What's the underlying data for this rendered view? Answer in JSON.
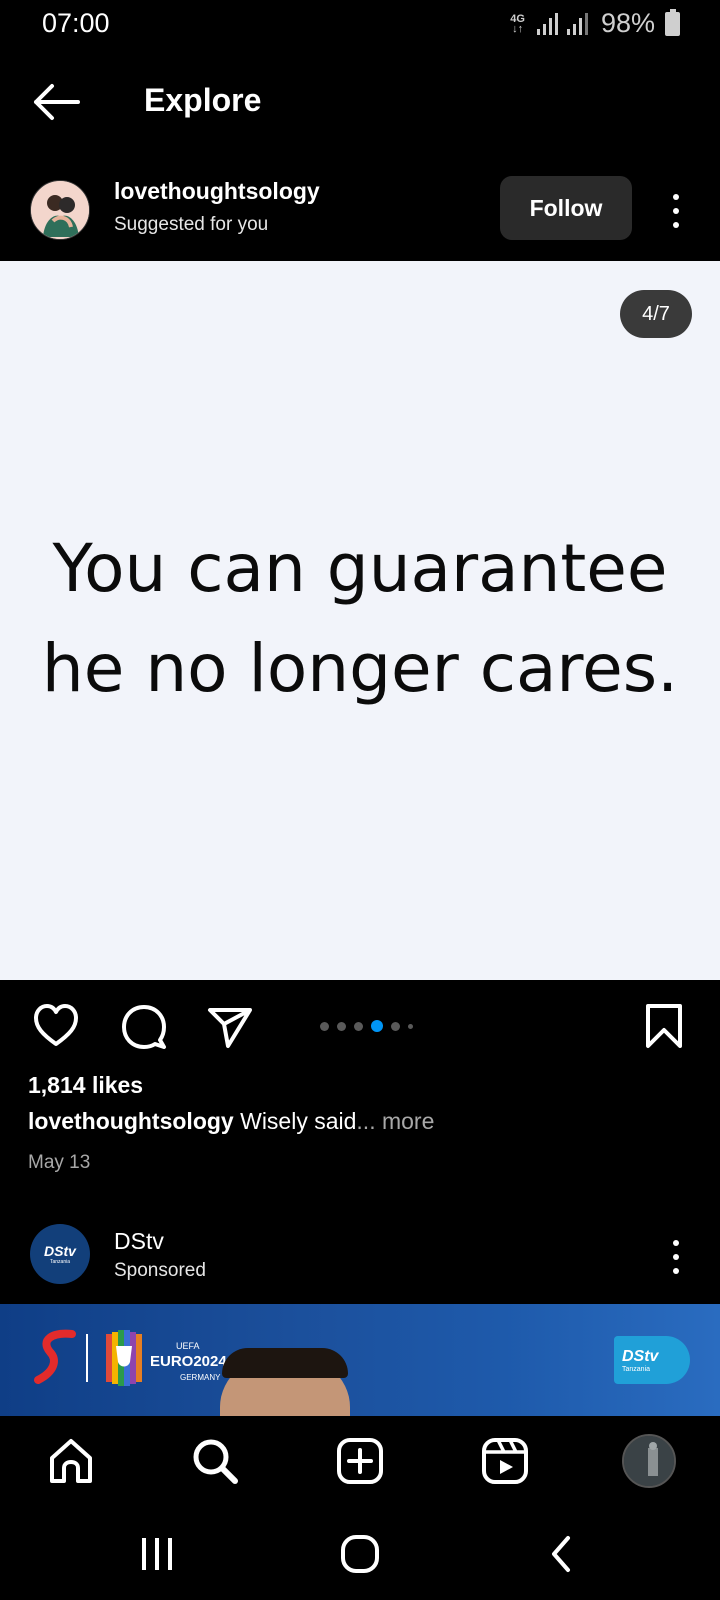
{
  "status_bar": {
    "time": "07:00",
    "network": "4G",
    "battery": "98%"
  },
  "header": {
    "title": "Explore"
  },
  "post": {
    "username": "lovethoughtsology",
    "subtitle": "Suggested for you",
    "follow_label": "Follow",
    "page_indicator": "4/7",
    "quote_line1": "You can guarantee",
    "quote_line2": "he no longer cares.",
    "likes": "1,814 likes",
    "caption_user": "lovethoughtsology",
    "caption_text": " Wisely said",
    "caption_more": "... more",
    "date": "May 13",
    "carousel": {
      "count": 6,
      "active_index": 3
    }
  },
  "sponsored": {
    "name": "DStv",
    "label": "Sponsored",
    "avatar_logo": "DStv",
    "avatar_region": "Tanzania",
    "banner": {
      "euro_small": "UEFA",
      "euro_title": "EURO2024",
      "euro_country": "GERMANY",
      "badge_logo": "DStv",
      "badge_region": "Tanzania"
    }
  },
  "bottom_nav": {
    "items": [
      {
        "icon": "home-icon"
      },
      {
        "icon": "search-icon"
      },
      {
        "icon": "create-icon"
      },
      {
        "icon": "reels-icon"
      },
      {
        "icon": "profile-avatar"
      }
    ]
  },
  "colors": {
    "accent": "#0095f6",
    "background": "#000000",
    "post_bg": "#f2f4fa"
  }
}
